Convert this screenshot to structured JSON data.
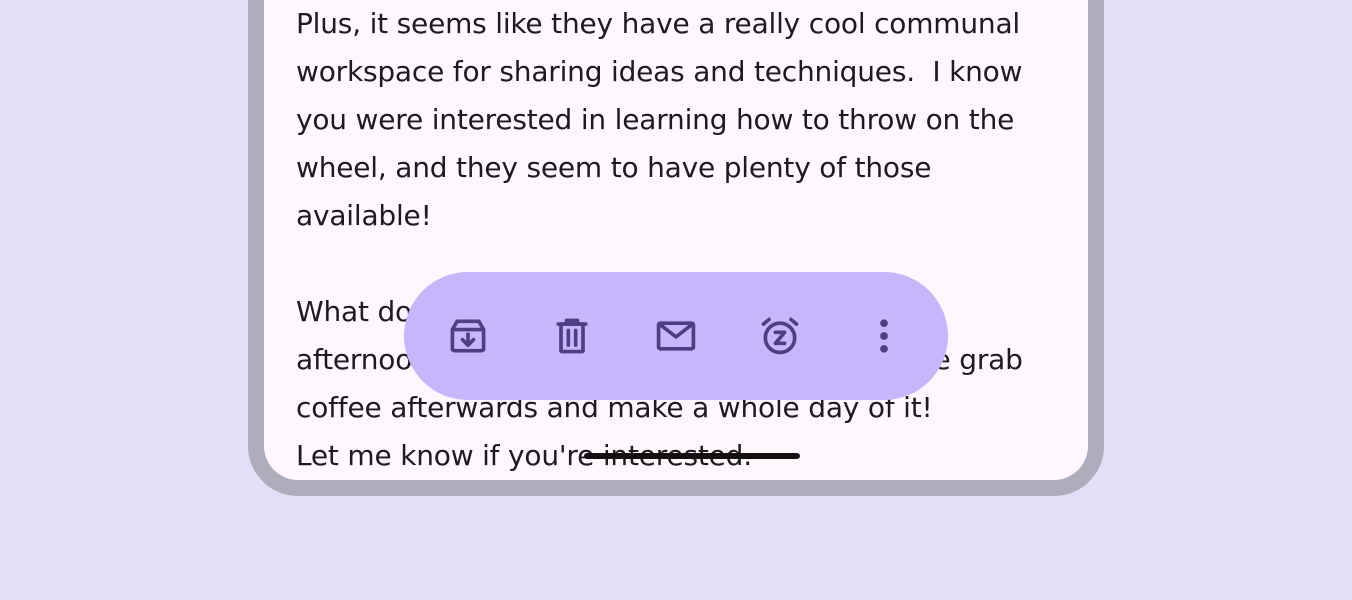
{
  "message": {
    "paragraph1": "Plus, it seems like they have a really cool communal\nworkspace for sharing ideas and techniques.  I know\nyou were interested in learning how to throw on the\nwheel, and they seem to have plenty of those\navailable!",
    "paragraph2": "What do you think? We could go on Saturday\nafternoon, take a class or two, and then maybe grab\ncoffee afterwards and make a whole day of it!\nLet me know if you're interested."
  },
  "toolbar": {
    "background": "#c8b6fb",
    "icon_color": "#4f3d86",
    "actions": [
      {
        "name": "archive",
        "icon": "archive-icon"
      },
      {
        "name": "delete",
        "icon": "trash-icon"
      },
      {
        "name": "mark-unread",
        "icon": "mail-icon"
      },
      {
        "name": "snooze",
        "icon": "snooze-alarm-icon"
      },
      {
        "name": "more",
        "icon": "more-vert-icon"
      }
    ]
  }
}
